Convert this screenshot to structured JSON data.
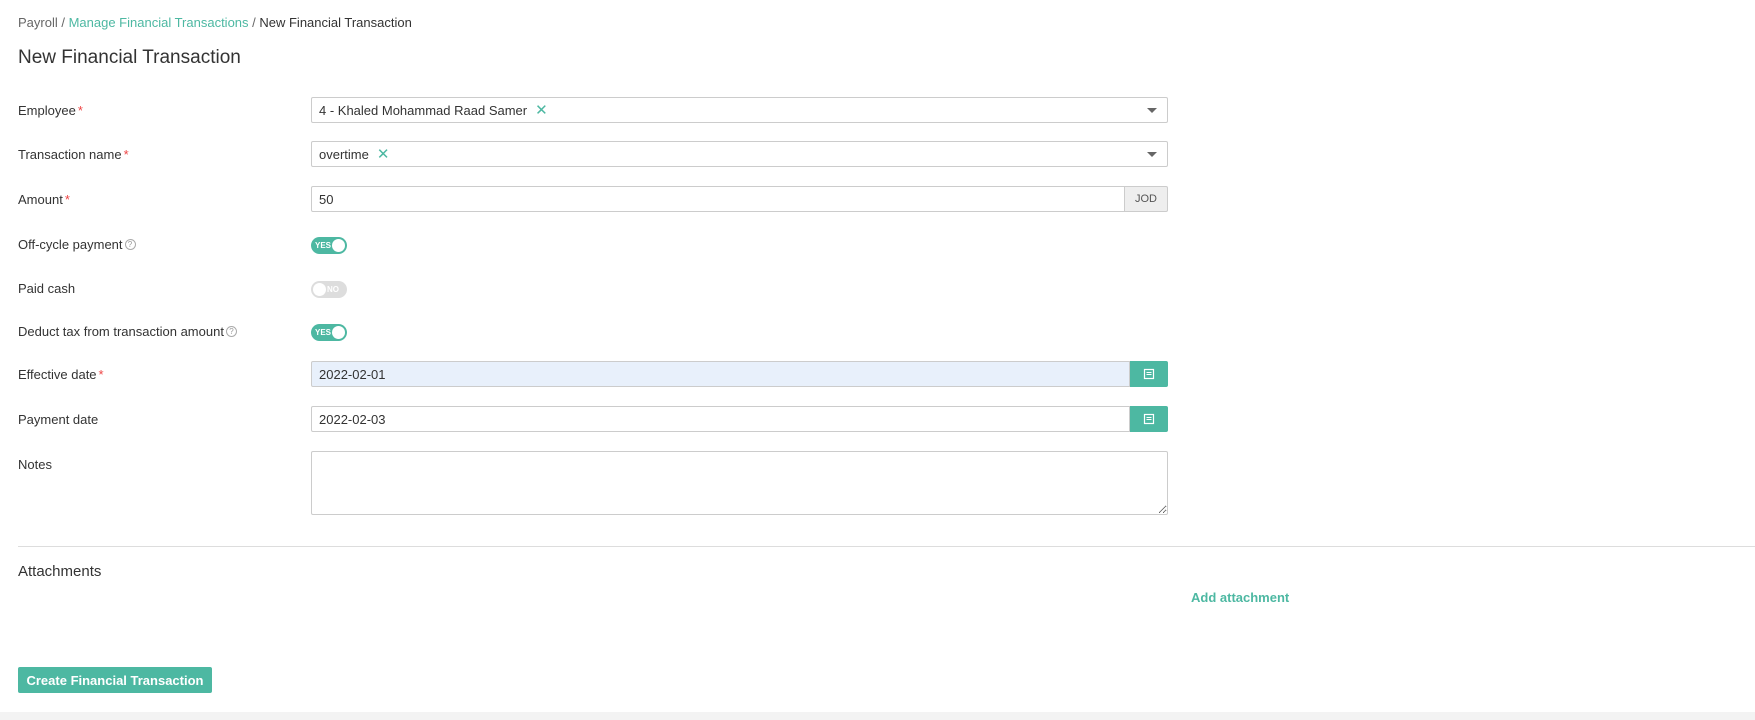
{
  "breadcrumb": {
    "root": "Payroll",
    "separator": " / ",
    "parent": "Manage Financial Transactions",
    "current": "New Financial Transaction"
  },
  "page_title": "New Financial Transaction",
  "form": {
    "employee": {
      "label": "Employee",
      "required_mark": "*",
      "value": "4 - Khaled Mohammad Raad Samer"
    },
    "transaction_name": {
      "label": "Transaction name",
      "required_mark": "*",
      "value": "overtime"
    },
    "amount": {
      "label": "Amount",
      "required_mark": "*",
      "value": "50",
      "currency": "JOD"
    },
    "off_cycle_payment": {
      "label": "Off-cycle payment",
      "state": "YES",
      "help": "?"
    },
    "paid_cash": {
      "label": "Paid cash",
      "state": "NO"
    },
    "deduct_tax": {
      "label": "Deduct tax from transaction amount",
      "state": "YES",
      "help": "?"
    },
    "effective_date": {
      "label": "Effective date",
      "required_mark": "*",
      "value": "2022-02-01"
    },
    "payment_date": {
      "label": "Payment date",
      "value": "2022-02-03"
    },
    "notes": {
      "label": "Notes",
      "value": ""
    }
  },
  "attachments": {
    "title": "Attachments",
    "add_label": "Add attachment"
  },
  "submit_label": "Create Financial Transaction",
  "colors": {
    "accent": "#4db8a2",
    "required": "#e44444",
    "highlight_input": "#e8f0fb"
  },
  "icons": {
    "clear": "clear-icon",
    "dropdown": "chevron-down-icon",
    "calendar": "calendar-icon",
    "help": "help-icon"
  }
}
